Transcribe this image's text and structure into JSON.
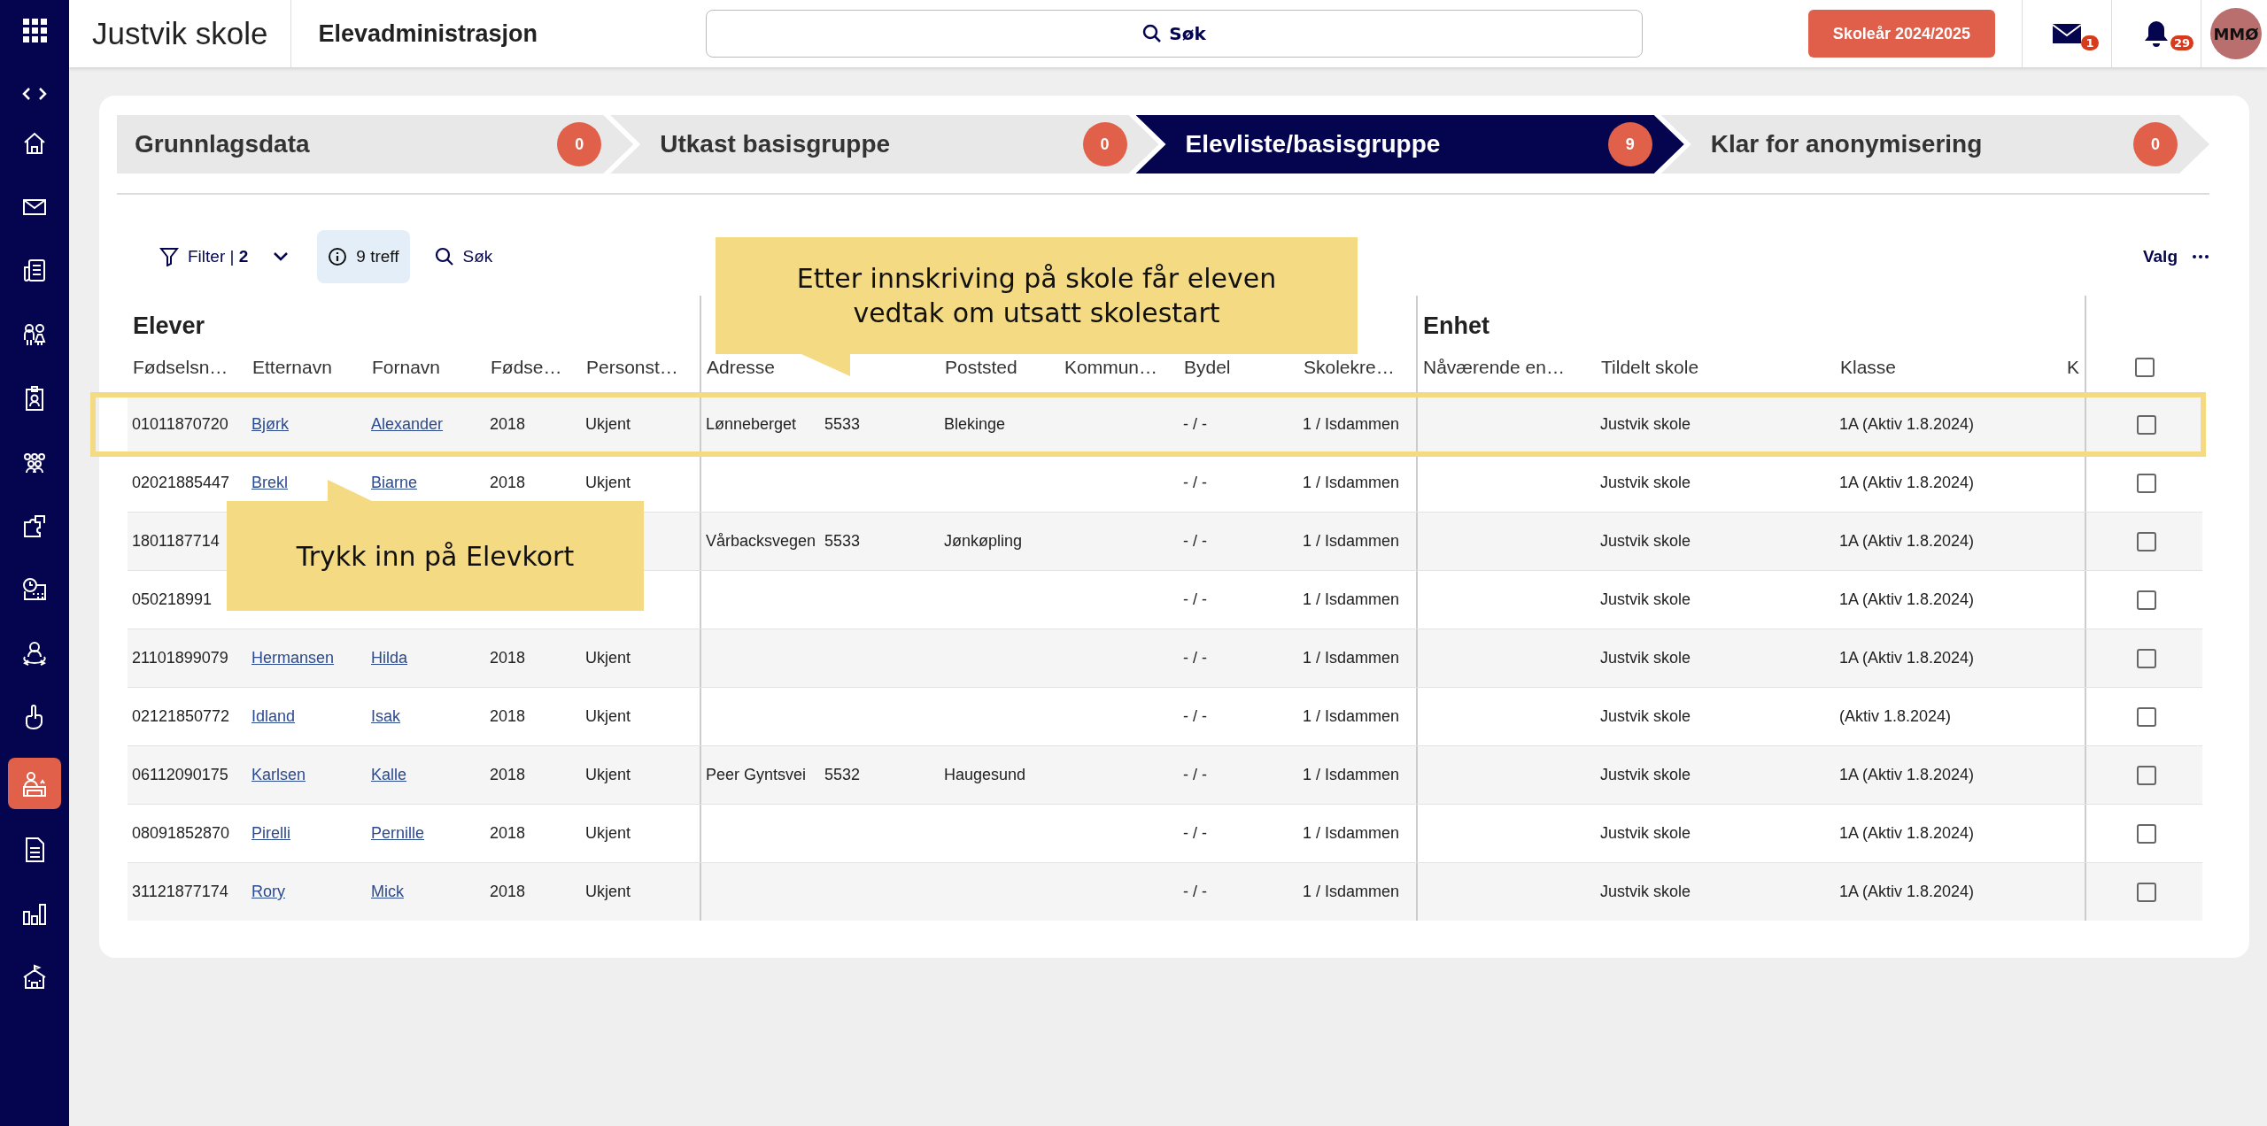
{
  "top_bar": {
    "app_title": "Justvik skole",
    "module_title": "Elevadministrasjon",
    "search_button": "Søk",
    "school_year_button": "Skoleår 2024/2025",
    "mail_badge": "1",
    "notification_badge": "29",
    "avatar_initials": "MMØ"
  },
  "sidebar": {
    "items": [
      {
        "selected": false
      },
      {
        "selected": false
      },
      {
        "selected": false
      },
      {
        "selected": false
      },
      {
        "selected": false
      },
      {
        "selected": false
      },
      {
        "selected": false
      },
      {
        "selected": false
      },
      {
        "selected": false
      },
      {
        "selected": false
      },
      {
        "selected": true
      },
      {
        "selected": false
      },
      {
        "selected": false
      },
      {
        "selected": false
      }
    ]
  },
  "steps": [
    {
      "label": "Grunnlagsdata",
      "count": "0",
      "selected": false
    },
    {
      "label": "Utkast basisgruppe",
      "count": "0",
      "selected": false
    },
    {
      "label": "Elevliste/basisgruppe",
      "count": "9",
      "selected": true
    },
    {
      "label": "Klar for anonymisering",
      "count": "0",
      "selected": false
    }
  ],
  "toolbar": {
    "filter": "Filter | **2**",
    "hits": "9 treff",
    "search": "Søk",
    "options": "Valg"
  },
  "table": {
    "groups": [
      "Elever",
      "Enhet"
    ],
    "columns": [
      "Fødselsn…",
      "Etternavn",
      "Fornavn",
      "Fødse…",
      "Personst…",
      "Adresse",
      null,
      "Poststed",
      "Kommun…",
      "Bydel",
      "Skolekre…",
      "Nåværende en…",
      "Tildelt skole",
      "Klasse",
      "K"
    ],
    "header_checked": false,
    "rows": [
      {
        "cells": [
          "01011870720",
          "Bjørk",
          "Alexander",
          "2018",
          "Ukjent",
          "Lønneberget",
          "5533",
          "Blekinge",
          null,
          "- / -",
          "1 / Isdammen",
          null,
          "Justvik skole",
          "1A (Aktiv 1.8.2024)",
          null
        ],
        "checked": false,
        "highlighted": true
      },
      {
        "cells": [
          "02021885447",
          "Brekl",
          "Biarne",
          "2018",
          "Ukjent",
          null,
          null,
          null,
          null,
          "- / -",
          "1 / Isdammen",
          null,
          "Justvik skole",
          "1A (Aktiv 1.8.2024)",
          null
        ],
        "checked": false,
        "highlighted": false
      },
      {
        "cells": [
          "1801187714",
          null,
          null,
          null,
          null,
          "Vårbacksvegen",
          "5533",
          "Jønkøpling",
          null,
          "- / -",
          "1 / Isdammen",
          null,
          "Justvik skole",
          "1A (Aktiv 1.8.2024)",
          null
        ],
        "checked": false,
        "highlighted": false
      },
      {
        "cells": [
          "050218991",
          null,
          null,
          null,
          null,
          null,
          null,
          null,
          null,
          "- / -",
          "1 / Isdammen",
          null,
          "Justvik skole",
          "1A (Aktiv 1.8.2024)",
          null
        ],
        "checked": false,
        "highlighted": false
      },
      {
        "cells": [
          "21101899079",
          "Hermansen",
          "Hilda",
          "2018",
          "Ukjent",
          null,
          null,
          null,
          null,
          "- / -",
          "1 / Isdammen",
          null,
          "Justvik skole",
          "1A (Aktiv 1.8.2024)",
          null
        ],
        "checked": false,
        "highlighted": false
      },
      {
        "cells": [
          "02121850772",
          "Idland",
          "Isak",
          "2018",
          "Ukjent",
          null,
          null,
          null,
          null,
          "- / -",
          "1 / Isdammen",
          null,
          "Justvik skole",
          "(Aktiv 1.8.2024)",
          null
        ],
        "checked": false,
        "highlighted": false
      },
      {
        "cells": [
          "06112090175",
          "Karlsen",
          "Kalle",
          "2018",
          "Ukjent",
          "Peer Gyntsvei",
          "5532",
          "Haugesund",
          null,
          "- / -",
          "1 / Isdammen",
          null,
          "Justvik skole",
          "1A (Aktiv 1.8.2024)",
          null
        ],
        "checked": false,
        "highlighted": false
      },
      {
        "cells": [
          "08091852870",
          "Pirelli",
          "Pernille",
          "2018",
          "Ukjent",
          null,
          null,
          null,
          null,
          "- / -",
          "1 / Isdammen",
          null,
          "Justvik skole",
          "1A (Aktiv 1.8.2024)",
          null
        ],
        "checked": false,
        "highlighted": false
      },
      {
        "cells": [
          "31121877174",
          "Rory",
          "Mick",
          "2018",
          "Ukjent",
          null,
          null,
          null,
          null,
          "- / -",
          "1 / Isdammen",
          null,
          "Justvik skole",
          "1A (Aktiv 1.8.2024)",
          null
        ],
        "checked": false,
        "highlighted": false
      }
    ]
  },
  "callouts": [
    "Etter innskriving på skole får eleven vedtak om utsatt skolestart",
    "Trykk inn på Elevkort"
  ]
}
